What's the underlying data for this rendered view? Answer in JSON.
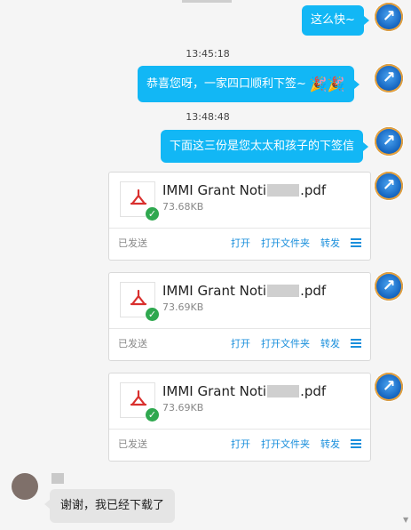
{
  "messages": {
    "m1": {
      "text": "这么快~"
    },
    "t1": "13:45:18",
    "m2": {
      "text": "恭喜您呀，一家四口顺利下签~",
      "emoji": "🎉🎉"
    },
    "t2": "13:48:48",
    "m3": {
      "text": "下面这三份是您太太和孩子的下签信"
    },
    "files": [
      {
        "name_prefix": "IMMI Grant Noti",
        "name_suffix": ".pdf",
        "size": "73.68KB",
        "status": "已发送",
        "actions": [
          "打开",
          "打开文件夹",
          "转发"
        ]
      },
      {
        "name_prefix": "IMMI Grant Noti",
        "name_suffix": ".pdf",
        "size": "73.69KB",
        "status": "已发送",
        "actions": [
          "打开",
          "打开文件夹",
          "转发"
        ]
      },
      {
        "name_prefix": "IMMI Grant Noti",
        "name_suffix": ".pdf",
        "size": "73.69KB",
        "status": "已发送",
        "actions": [
          "打开",
          "打开文件夹",
          "转发"
        ]
      }
    ],
    "reply": {
      "text": "谢谢，我已经下载了"
    }
  },
  "colors": {
    "bubble_blue": "#12b7f5",
    "link": "#1a8fdc",
    "check": "#2fa84f",
    "pdf_red": "#d9302e"
  },
  "icons": {
    "avatar": "user-avatar",
    "pdf": "pdf-file-icon",
    "check": "check-circle-icon",
    "menu": "menu-icon"
  }
}
